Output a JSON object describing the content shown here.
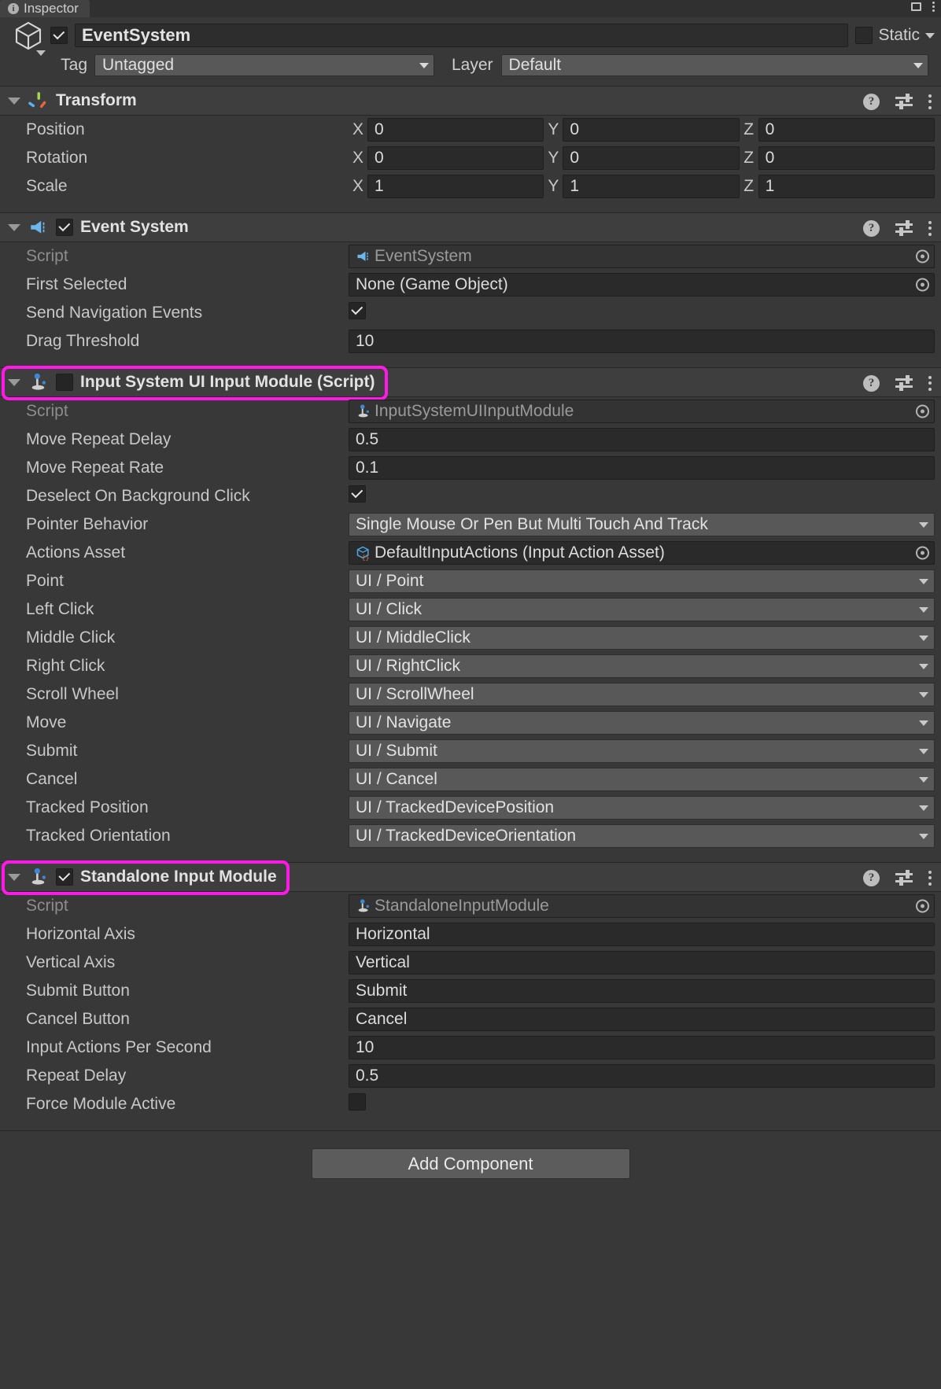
{
  "tab": {
    "label": "Inspector",
    "icon": "info-icon"
  },
  "object": {
    "enabled": true,
    "name": "EventSystem",
    "static_label": "Static",
    "static_checked": false,
    "tag_label": "Tag",
    "tag_value": "Untagged",
    "layer_label": "Layer",
    "layer_value": "Default"
  },
  "components": [
    {
      "id": "transform",
      "title": "Transform",
      "icon": "transform-axis-icon",
      "has_checkbox": false,
      "highlighted": false,
      "rows": [
        {
          "label": "Position",
          "type": "vector3",
          "axes": [
            "X",
            "Y",
            "Z"
          ],
          "values": [
            "0",
            "0",
            "0"
          ]
        },
        {
          "label": "Rotation",
          "type": "vector3",
          "axes": [
            "X",
            "Y",
            "Z"
          ],
          "values": [
            "0",
            "0",
            "0"
          ]
        },
        {
          "label": "Scale",
          "type": "vector3",
          "axes": [
            "X",
            "Y",
            "Z"
          ],
          "values": [
            "1",
            "1",
            "1"
          ]
        }
      ]
    },
    {
      "id": "event-system",
      "title": "Event System",
      "icon": "megaphone-icon",
      "has_checkbox": true,
      "checked": true,
      "highlighted": false,
      "rows": [
        {
          "label": "Script",
          "dim": true,
          "type": "object",
          "value": "EventSystem",
          "icon": "megaphone-icon",
          "readonly": true
        },
        {
          "label": "First Selected",
          "type": "object",
          "value": "None (Game Object)"
        },
        {
          "label": "Send Navigation Events",
          "type": "checkbox",
          "checked": true
        },
        {
          "label": "Drag Threshold",
          "type": "text",
          "value": "10"
        }
      ]
    },
    {
      "id": "input-system-ui-input-module",
      "title": "Input System UI Input Module (Script)",
      "icon": "joystick-icon",
      "has_checkbox": true,
      "checked": false,
      "highlighted": true,
      "rows": [
        {
          "label": "Script",
          "dim": true,
          "type": "object",
          "value": "InputSystemUIInputModule",
          "icon": "joystick-icon",
          "readonly": true
        },
        {
          "label": "Move Repeat Delay",
          "type": "text",
          "value": "0.5"
        },
        {
          "label": "Move Repeat Rate",
          "type": "text",
          "value": "0.1"
        },
        {
          "label": "Deselect On Background Click",
          "type": "checkbox",
          "checked": true
        },
        {
          "label": "Pointer Behavior",
          "type": "dropdown",
          "value": "Single Mouse Or Pen But Multi Touch And Track"
        },
        {
          "label": "Actions Asset",
          "type": "object",
          "value": "DefaultInputActions (Input Action Asset)",
          "icon": "input-action-asset-icon"
        },
        {
          "label": "Point",
          "type": "dropdown",
          "value": "UI / Point"
        },
        {
          "label": "Left Click",
          "type": "dropdown",
          "value": "UI / Click"
        },
        {
          "label": "Middle Click",
          "type": "dropdown",
          "value": "UI / MiddleClick"
        },
        {
          "label": "Right Click",
          "type": "dropdown",
          "value": "UI / RightClick"
        },
        {
          "label": "Scroll Wheel",
          "type": "dropdown",
          "value": "UI / ScrollWheel"
        },
        {
          "label": "Move",
          "type": "dropdown",
          "value": "UI / Navigate"
        },
        {
          "label": "Submit",
          "type": "dropdown",
          "value": "UI / Submit"
        },
        {
          "label": "Cancel",
          "type": "dropdown",
          "value": "UI / Cancel"
        },
        {
          "label": "Tracked Position",
          "type": "dropdown",
          "value": "UI / TrackedDevicePosition"
        },
        {
          "label": "Tracked Orientation",
          "type": "dropdown",
          "value": "UI / TrackedDeviceOrientation"
        }
      ]
    },
    {
      "id": "standalone-input-module",
      "title": "Standalone Input Module",
      "icon": "joystick-icon",
      "has_checkbox": true,
      "checked": true,
      "highlighted": true,
      "rows": [
        {
          "label": "Script",
          "dim": true,
          "type": "object",
          "value": "StandaloneInputModule",
          "icon": "joystick-icon",
          "readonly": true
        },
        {
          "label": "Horizontal Axis",
          "type": "text",
          "value": "Horizontal"
        },
        {
          "label": "Vertical Axis",
          "type": "text",
          "value": "Vertical"
        },
        {
          "label": "Submit Button",
          "type": "text",
          "value": "Submit"
        },
        {
          "label": "Cancel Button",
          "type": "text",
          "value": "Cancel"
        },
        {
          "label": "Input Actions Per Second",
          "type": "text",
          "value": "10"
        },
        {
          "label": "Repeat Delay",
          "type": "text",
          "value": "0.5"
        },
        {
          "label": "Force Module Active",
          "type": "checkbox",
          "checked": false
        }
      ]
    }
  ],
  "footer": {
    "add_component_label": "Add Component"
  },
  "component_header_icons": {
    "help": "?",
    "preset": "preset-icon",
    "menu": "kebab-icon"
  },
  "colors": {
    "highlight": "#ff19e6",
    "accent_blue": "#5ab0f0",
    "background": "#383838"
  }
}
